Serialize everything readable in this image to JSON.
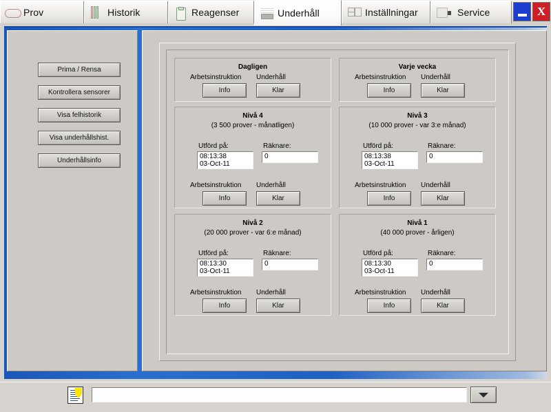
{
  "window": {
    "minimize_label": "",
    "close_label": "X"
  },
  "tabs": [
    {
      "label": "Prov",
      "icon": "flask-icon",
      "active": false
    },
    {
      "label": "Historik",
      "icon": "bars-icon",
      "active": false
    },
    {
      "label": "Reagenser",
      "icon": "bottle-icon",
      "active": false
    },
    {
      "label": "Underhåll",
      "icon": "wrench-icon",
      "active": true
    },
    {
      "label": "Inställningar",
      "icon": "sliders-icon",
      "active": false
    },
    {
      "label": "Service",
      "icon": "service-icon",
      "active": false
    }
  ],
  "sidebar": {
    "buttons": [
      {
        "label": "Prima / Rensa"
      },
      {
        "label": "Kontrollera sensorer"
      },
      {
        "label": "Visa felhistorik"
      },
      {
        "label": "Visa underhållshist."
      },
      {
        "label": "Underhållsinfo"
      }
    ]
  },
  "labels": {
    "arbetsinstruktion": "Arbetsinstruktion",
    "underhall": "Underhåll",
    "utford_pa": "Utförd på:",
    "raknare": "Räknare:",
    "info": "Info",
    "klar": "Klar"
  },
  "panels": [
    {
      "id": "dagligen",
      "title": "Dagligen",
      "subtitle": "",
      "has_fields": false,
      "info_label": "Info",
      "klar_label": "Klar"
    },
    {
      "id": "varje-vecka",
      "title": "Varje vecka",
      "subtitle": "",
      "has_fields": false,
      "info_label": "Info",
      "klar_label": "Klar"
    },
    {
      "id": "niva-4",
      "title": "Nivå 4",
      "subtitle": "(3 500 prover - månatligen)",
      "has_fields": true,
      "time": "08:13:38",
      "date": "03-Oct-11",
      "counter": "0",
      "info_label": "Info",
      "klar_label": "Klar"
    },
    {
      "id": "niva-3",
      "title": "Nivå 3",
      "subtitle": "(10 000 prover - var 3:e månad)",
      "has_fields": true,
      "time": "08:13:38",
      "date": "03-Oct-11",
      "counter": "0",
      "info_label": "Info",
      "klar_label": "Klar"
    },
    {
      "id": "niva-2",
      "title": "Nivå 2",
      "subtitle": "(20 000 prover - var 6:e månad)",
      "has_fields": true,
      "time": "08:13:30",
      "date": "03-Oct-11",
      "counter": "0",
      "info_label": "Info",
      "klar_label": "Klar"
    },
    {
      "id": "niva-1",
      "title": "Nivå 1",
      "subtitle": "(40 000 prover - årligen)",
      "has_fields": true,
      "time": "08:13:30",
      "date": "03-Oct-11",
      "counter": "0",
      "info_label": "Info",
      "klar_label": "Klar"
    }
  ],
  "statusbar": {
    "icon": "document-note-icon",
    "message": "",
    "message_placeholder": "",
    "dropdown_icon": "chevron-down-icon"
  },
  "colors": {
    "accent_blue": "#1d5fc0",
    "face": "#cdcac5",
    "close_red": "#cf1f26",
    "minimize_blue": "#1c3fd0"
  }
}
